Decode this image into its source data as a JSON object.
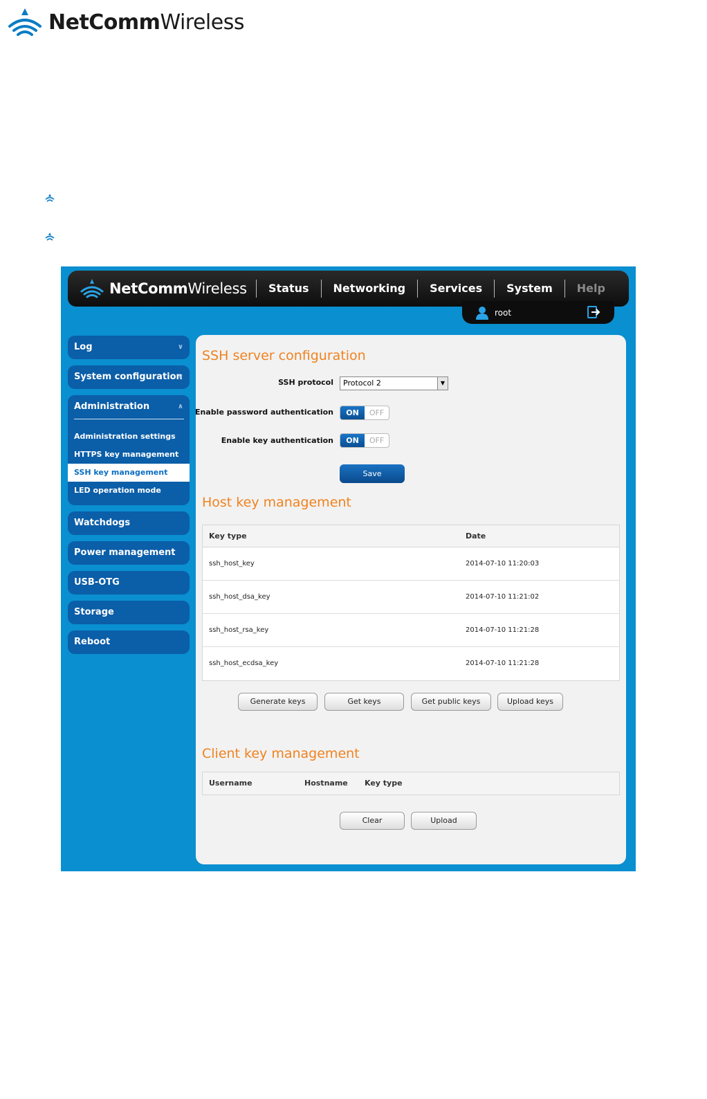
{
  "doc": {
    "brand_bold": "NetComm",
    "brand_light": "Wireless"
  },
  "app": {
    "brand_bold": "NetComm",
    "brand_light": "Wireless",
    "nav": [
      "Status",
      "Networking",
      "Services",
      "System",
      "Help"
    ],
    "user": "root"
  },
  "sidebar": {
    "log": "Log",
    "system_configuration": "System configuration",
    "administration": "Administration",
    "admin_items": [
      "Administration settings",
      "HTTPS key management",
      "SSH key management",
      "LED operation mode"
    ],
    "others": [
      "Watchdogs",
      "Power management",
      "USB-OTG",
      "Storage",
      "Reboot"
    ]
  },
  "ssh": {
    "title": "SSH server configuration",
    "protocol_label": "SSH protocol",
    "protocol_value": "Protocol 2",
    "password_auth_label": "Enable password authentication",
    "key_auth_label": "Enable key authentication",
    "on": "ON",
    "off": "OFF",
    "save": "Save"
  },
  "host": {
    "title": "Host key management",
    "col_key_type": "Key type",
    "col_date": "Date",
    "rows": [
      {
        "key": "ssh_host_key",
        "date": "2014-07-10 11:20:03"
      },
      {
        "key": "ssh_host_dsa_key",
        "date": "2014-07-10 11:21:02"
      },
      {
        "key": "ssh_host_rsa_key",
        "date": "2014-07-10 11:21:28"
      },
      {
        "key": "ssh_host_ecdsa_key",
        "date": "2014-07-10 11:21:28"
      }
    ],
    "buttons": [
      "Generate keys",
      "Get keys",
      "Get public keys",
      "Upload keys"
    ]
  },
  "client": {
    "title": "Client key management",
    "col_username": "Username",
    "col_hostname": "Hostname",
    "col_key_type": "Key type",
    "buttons": [
      "Clear",
      "Upload"
    ]
  },
  "colors": {
    "frame": "#0a8fd0",
    "sidebar": "#0b5ea8",
    "accent": "#f0821e",
    "topbar": "#111111"
  },
  "icons": {
    "logo": "wifi-arc-logo-icon",
    "user": "user-icon",
    "logout": "logout-icon",
    "bullet": "netcomm-bullet-icon",
    "chevron": "chevron-icon"
  }
}
